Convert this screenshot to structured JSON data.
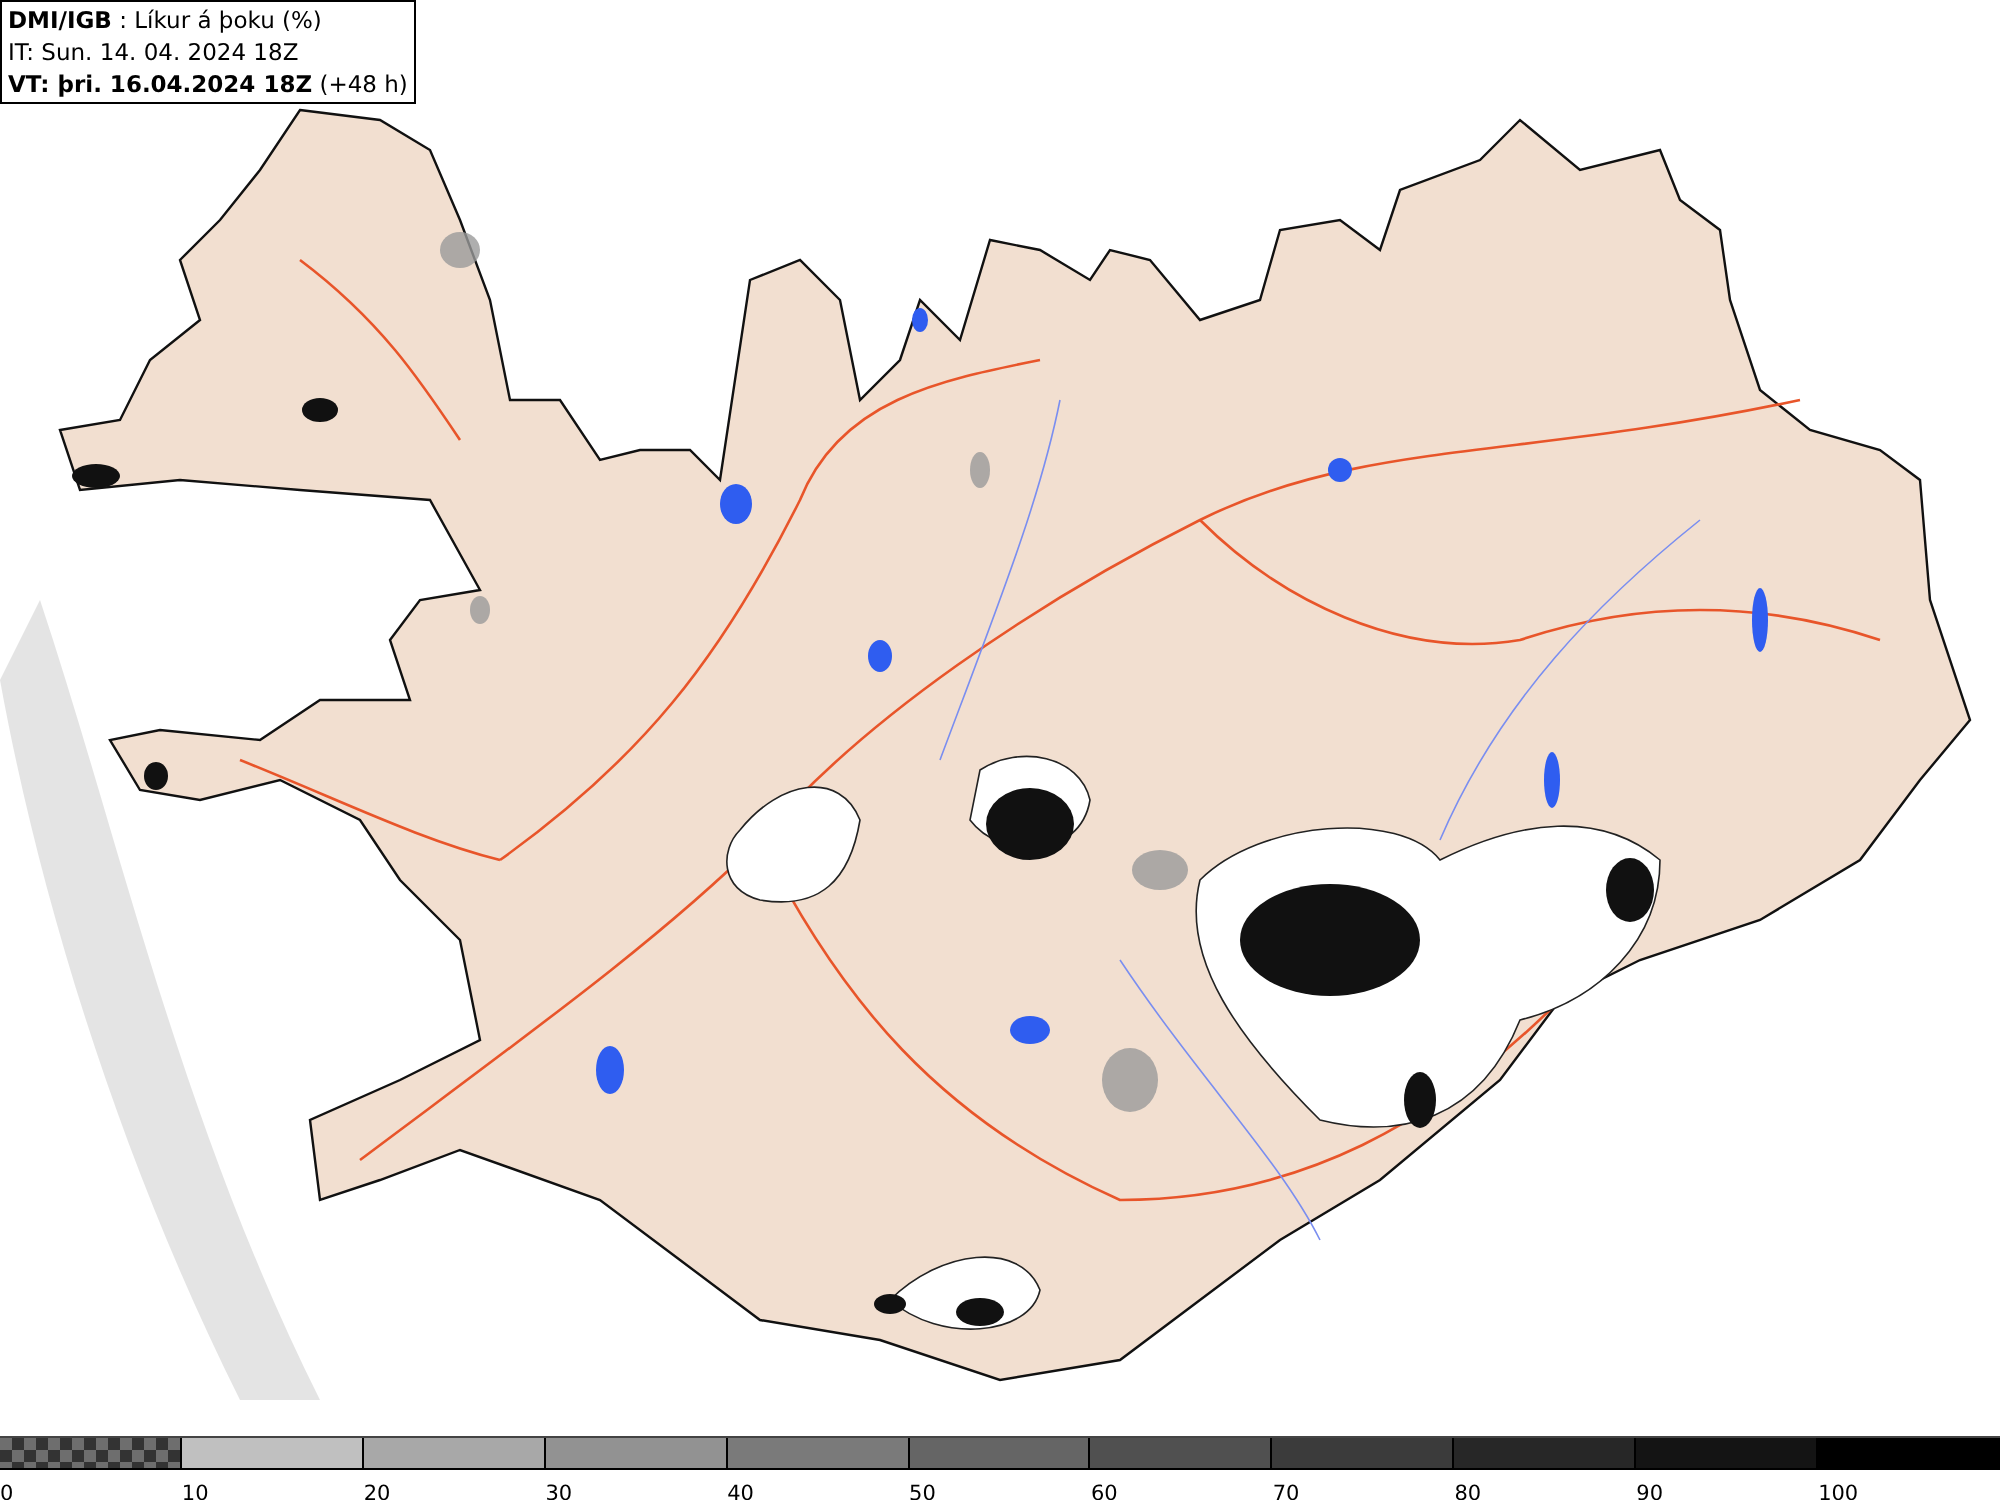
{
  "header": {
    "title": "**DMI/IGB** : Líkur á þoku (%)",
    "init_time": "IT: Sun. 14. 04. 2024 18Z",
    "valid_time": "**VT: þri. 16.04.2024 18Z** (+48 h)"
  },
  "legend": {
    "segments": [
      {
        "kind": "checker",
        "label": "0",
        "color": "#6e6e6e"
      },
      {
        "kind": "solid",
        "label": "10",
        "color": "#c0c0c0"
      },
      {
        "kind": "solid",
        "label": "20",
        "color": "#a8a8a8"
      },
      {
        "kind": "solid",
        "label": "30",
        "color": "#929292"
      },
      {
        "kind": "solid",
        "label": "40",
        "color": "#7a7a7a"
      },
      {
        "kind": "solid",
        "label": "50",
        "color": "#656565"
      },
      {
        "kind": "solid",
        "label": "60",
        "color": "#505050"
      },
      {
        "kind": "solid",
        "label": "70",
        "color": "#3b3b3b"
      },
      {
        "kind": "solid",
        "label": "80",
        "color": "#272727"
      },
      {
        "kind": "solid",
        "label": "90",
        "color": "#141414"
      },
      {
        "kind": "solid",
        "label": "100",
        "color": "#000000"
      }
    ]
  }
}
